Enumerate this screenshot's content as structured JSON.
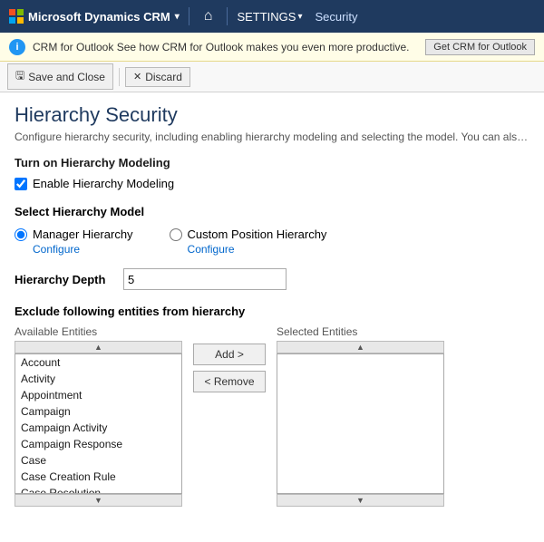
{
  "topbar": {
    "logo_text": "Microsoft Dynamics CRM",
    "logo_caret": "▾",
    "home_icon": "⌂",
    "settings_label": "SETTINGS",
    "settings_caret": "▾",
    "section_label": "Security"
  },
  "infobar": {
    "icon_text": "i",
    "message": "CRM for Outlook  See how CRM for Outlook makes you even more productive.",
    "button_label": "Get CRM for Outlook"
  },
  "toolbar": {
    "save_close_label": "Save and Close",
    "discard_label": "Discard",
    "save_icon": "💾",
    "discard_icon": "✕"
  },
  "page": {
    "title": "Hierarchy Security",
    "description": "Configure hierarchy security, including enabling hierarchy modeling and selecting the model. You can also specify h"
  },
  "turn_on_section": {
    "heading": "Turn on Hierarchy Modeling",
    "checkbox_label": "Enable Hierarchy Modeling",
    "checkbox_checked": true
  },
  "hierarchy_model_section": {
    "heading": "Select Hierarchy Model",
    "options": [
      {
        "id": "manager",
        "label": "Manager Hierarchy",
        "configure": "Configure",
        "selected": true
      },
      {
        "id": "custom",
        "label": "Custom Position Hierarchy",
        "configure": "Configure",
        "selected": false
      }
    ]
  },
  "hierarchy_depth": {
    "label": "Hierarchy Depth",
    "value": "5"
  },
  "exclude_section": {
    "heading": "Exclude following entities from hierarchy",
    "available_label": "Available Entities",
    "selected_label": "Selected Entities",
    "add_button": "Add >",
    "remove_button": "< Remove",
    "available_entities": [
      "Account",
      "Activity",
      "Appointment",
      "Campaign",
      "Campaign Activity",
      "Campaign Response",
      "Case",
      "Case Creation Rule",
      "Case Resolution"
    ],
    "selected_entities": []
  }
}
